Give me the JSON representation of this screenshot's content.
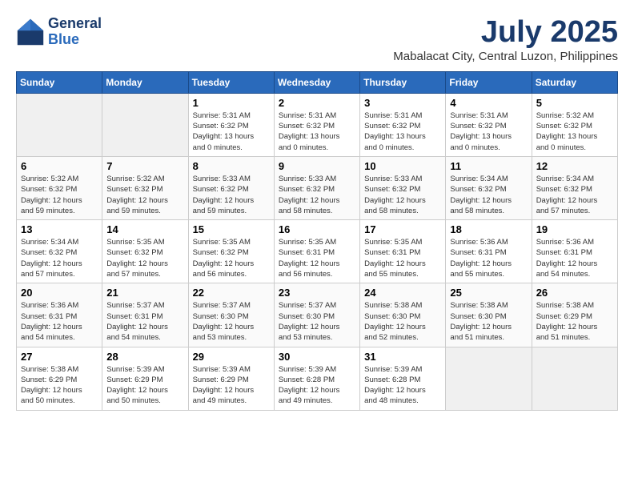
{
  "header": {
    "logo_line1": "General",
    "logo_line2": "Blue",
    "month": "July 2025",
    "location": "Mabalacat City, Central Luzon, Philippines"
  },
  "weekdays": [
    "Sunday",
    "Monday",
    "Tuesday",
    "Wednesday",
    "Thursday",
    "Friday",
    "Saturday"
  ],
  "weeks": [
    [
      {
        "day": "",
        "info": ""
      },
      {
        "day": "",
        "info": ""
      },
      {
        "day": "1",
        "info": "Sunrise: 5:31 AM\nSunset: 6:32 PM\nDaylight: 13 hours\nand 0 minutes."
      },
      {
        "day": "2",
        "info": "Sunrise: 5:31 AM\nSunset: 6:32 PM\nDaylight: 13 hours\nand 0 minutes."
      },
      {
        "day": "3",
        "info": "Sunrise: 5:31 AM\nSunset: 6:32 PM\nDaylight: 13 hours\nand 0 minutes."
      },
      {
        "day": "4",
        "info": "Sunrise: 5:31 AM\nSunset: 6:32 PM\nDaylight: 13 hours\nand 0 minutes."
      },
      {
        "day": "5",
        "info": "Sunrise: 5:32 AM\nSunset: 6:32 PM\nDaylight: 13 hours\nand 0 minutes."
      }
    ],
    [
      {
        "day": "6",
        "info": "Sunrise: 5:32 AM\nSunset: 6:32 PM\nDaylight: 12 hours\nand 59 minutes."
      },
      {
        "day": "7",
        "info": "Sunrise: 5:32 AM\nSunset: 6:32 PM\nDaylight: 12 hours\nand 59 minutes."
      },
      {
        "day": "8",
        "info": "Sunrise: 5:33 AM\nSunset: 6:32 PM\nDaylight: 12 hours\nand 59 minutes."
      },
      {
        "day": "9",
        "info": "Sunrise: 5:33 AM\nSunset: 6:32 PM\nDaylight: 12 hours\nand 58 minutes."
      },
      {
        "day": "10",
        "info": "Sunrise: 5:33 AM\nSunset: 6:32 PM\nDaylight: 12 hours\nand 58 minutes."
      },
      {
        "day": "11",
        "info": "Sunrise: 5:34 AM\nSunset: 6:32 PM\nDaylight: 12 hours\nand 58 minutes."
      },
      {
        "day": "12",
        "info": "Sunrise: 5:34 AM\nSunset: 6:32 PM\nDaylight: 12 hours\nand 57 minutes."
      }
    ],
    [
      {
        "day": "13",
        "info": "Sunrise: 5:34 AM\nSunset: 6:32 PM\nDaylight: 12 hours\nand 57 minutes."
      },
      {
        "day": "14",
        "info": "Sunrise: 5:35 AM\nSunset: 6:32 PM\nDaylight: 12 hours\nand 57 minutes."
      },
      {
        "day": "15",
        "info": "Sunrise: 5:35 AM\nSunset: 6:32 PM\nDaylight: 12 hours\nand 56 minutes."
      },
      {
        "day": "16",
        "info": "Sunrise: 5:35 AM\nSunset: 6:31 PM\nDaylight: 12 hours\nand 56 minutes."
      },
      {
        "day": "17",
        "info": "Sunrise: 5:35 AM\nSunset: 6:31 PM\nDaylight: 12 hours\nand 55 minutes."
      },
      {
        "day": "18",
        "info": "Sunrise: 5:36 AM\nSunset: 6:31 PM\nDaylight: 12 hours\nand 55 minutes."
      },
      {
        "day": "19",
        "info": "Sunrise: 5:36 AM\nSunset: 6:31 PM\nDaylight: 12 hours\nand 54 minutes."
      }
    ],
    [
      {
        "day": "20",
        "info": "Sunrise: 5:36 AM\nSunset: 6:31 PM\nDaylight: 12 hours\nand 54 minutes."
      },
      {
        "day": "21",
        "info": "Sunrise: 5:37 AM\nSunset: 6:31 PM\nDaylight: 12 hours\nand 54 minutes."
      },
      {
        "day": "22",
        "info": "Sunrise: 5:37 AM\nSunset: 6:30 PM\nDaylight: 12 hours\nand 53 minutes."
      },
      {
        "day": "23",
        "info": "Sunrise: 5:37 AM\nSunset: 6:30 PM\nDaylight: 12 hours\nand 53 minutes."
      },
      {
        "day": "24",
        "info": "Sunrise: 5:38 AM\nSunset: 6:30 PM\nDaylight: 12 hours\nand 52 minutes."
      },
      {
        "day": "25",
        "info": "Sunrise: 5:38 AM\nSunset: 6:30 PM\nDaylight: 12 hours\nand 51 minutes."
      },
      {
        "day": "26",
        "info": "Sunrise: 5:38 AM\nSunset: 6:29 PM\nDaylight: 12 hours\nand 51 minutes."
      }
    ],
    [
      {
        "day": "27",
        "info": "Sunrise: 5:38 AM\nSunset: 6:29 PM\nDaylight: 12 hours\nand 50 minutes."
      },
      {
        "day": "28",
        "info": "Sunrise: 5:39 AM\nSunset: 6:29 PM\nDaylight: 12 hours\nand 50 minutes."
      },
      {
        "day": "29",
        "info": "Sunrise: 5:39 AM\nSunset: 6:29 PM\nDaylight: 12 hours\nand 49 minutes."
      },
      {
        "day": "30",
        "info": "Sunrise: 5:39 AM\nSunset: 6:28 PM\nDaylight: 12 hours\nand 49 minutes."
      },
      {
        "day": "31",
        "info": "Sunrise: 5:39 AM\nSunset: 6:28 PM\nDaylight: 12 hours\nand 48 minutes."
      },
      {
        "day": "",
        "info": ""
      },
      {
        "day": "",
        "info": ""
      }
    ]
  ]
}
